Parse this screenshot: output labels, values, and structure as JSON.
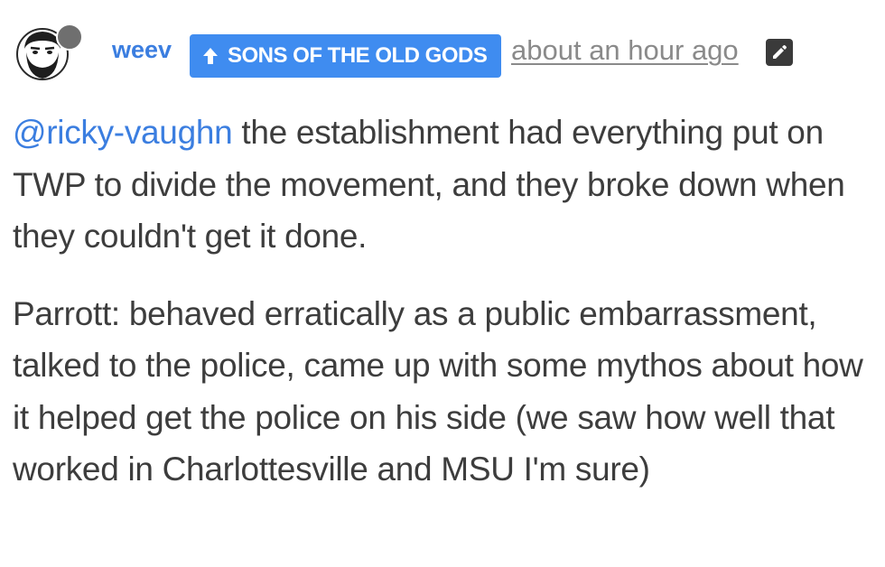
{
  "post": {
    "author": {
      "username": "weev",
      "group_badge": "SONS OF THE OLD GODS",
      "avatar_icon": "bearded-face-avatar",
      "status_icon": "gray-status-dot"
    },
    "timestamp": "about an hour ago",
    "edit_icon": "pencil-icon",
    "colors": {
      "link": "#3b7ee0",
      "badge_bg": "#3f8cf0",
      "text": "#3d3d3d",
      "muted": "#8a8a8a"
    },
    "paragraphs": [
      {
        "mention": "@ricky-vaughn",
        "text": " the establishment had everything put on TWP to divide the movement, and they broke down when they couldn't get it done."
      },
      {
        "text": "Parrott: behaved erratically as a public embarrassment, talked to the police, came up with some mythos about how it helped get the police on his side (we saw how well that worked in Charlottesville and MSU I'm sure)"
      }
    ]
  }
}
